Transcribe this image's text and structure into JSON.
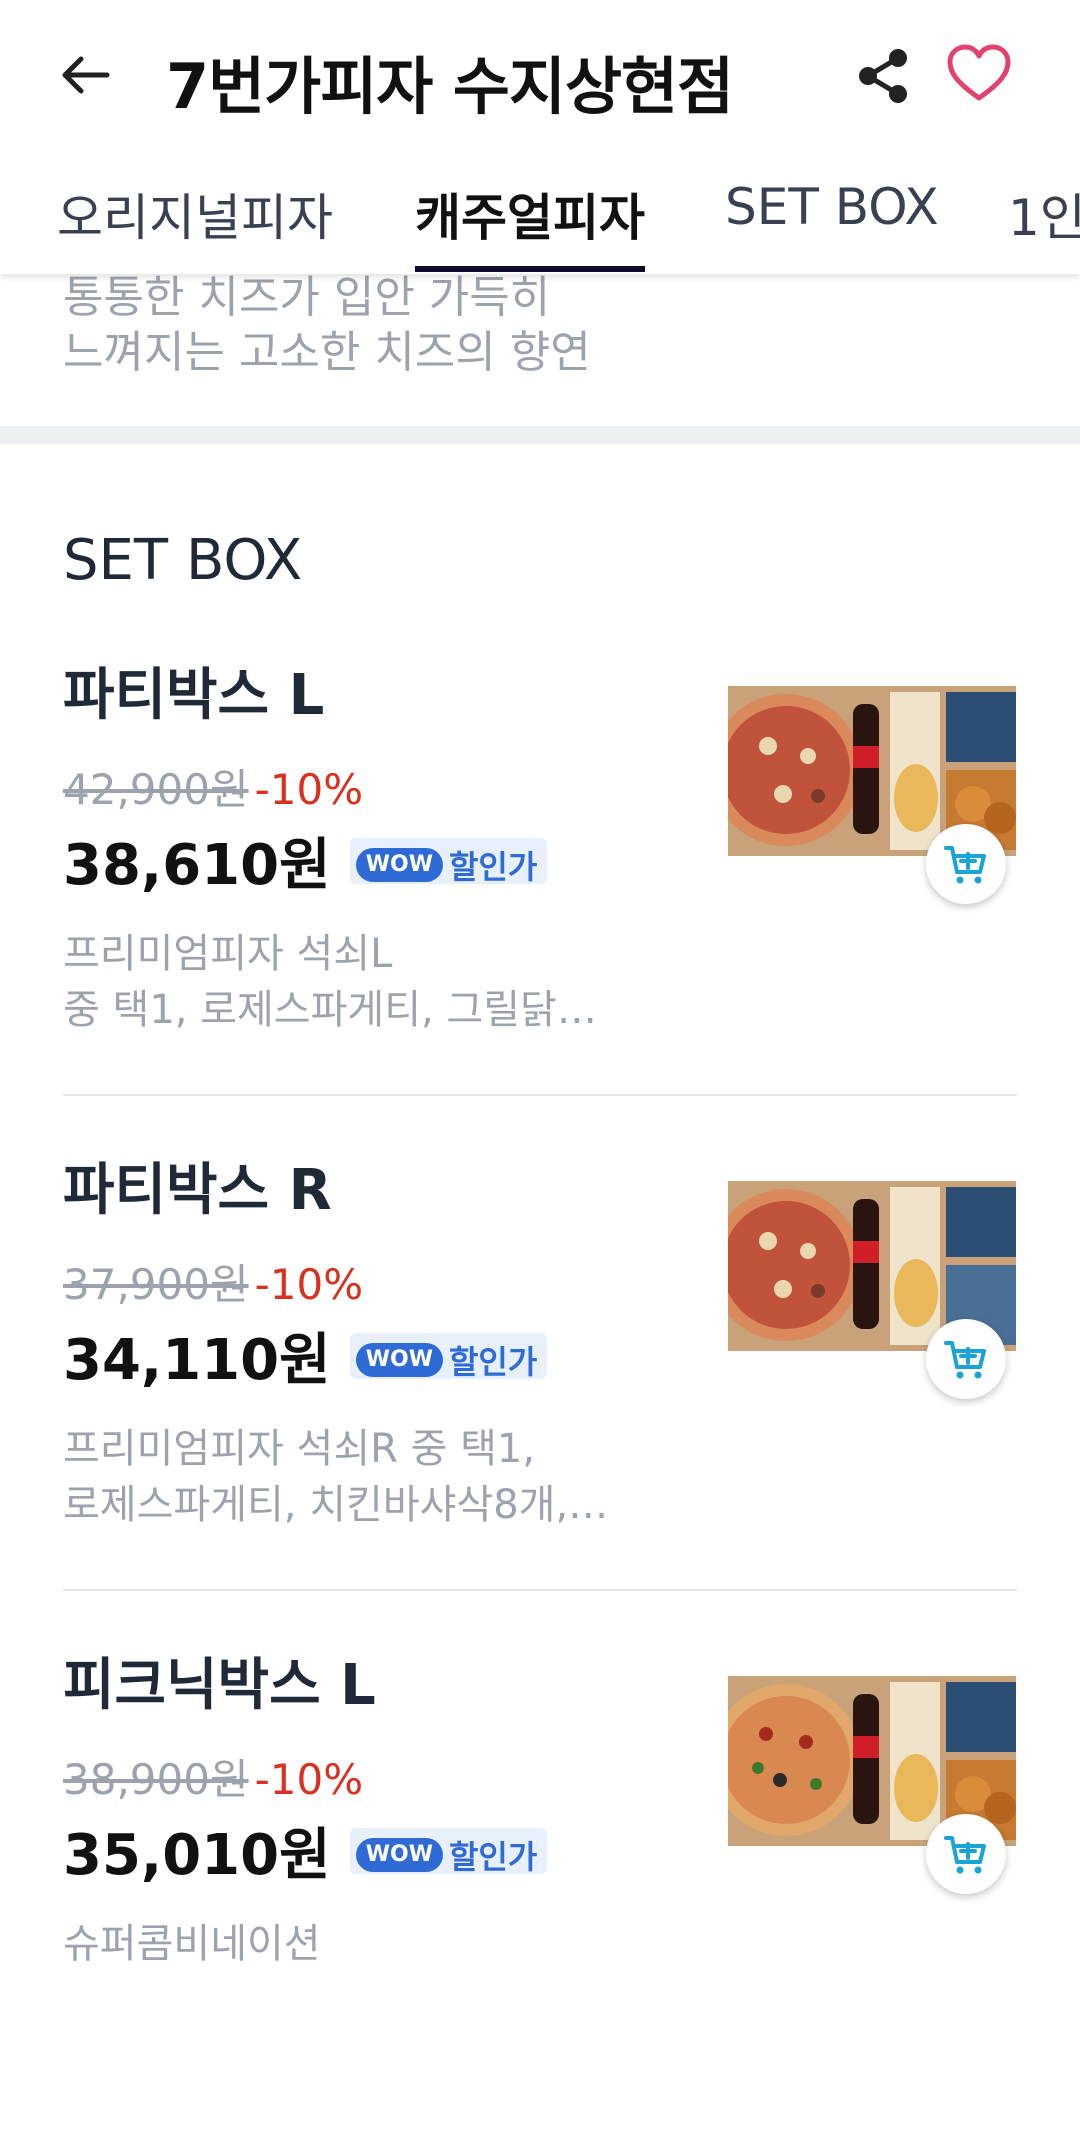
{
  "header": {
    "title": "7번가피자 수지상현점",
    "back_icon": "arrow-left-icon",
    "share_icon": "share-icon",
    "favorite_icon": "heart-icon",
    "favorite_color": "#e2436e"
  },
  "tabs": [
    {
      "label": "오리지널피자",
      "active": false
    },
    {
      "label": "캐주얼피자",
      "active": true
    },
    {
      "label": "SET BOX",
      "active": false
    },
    {
      "label": "1인",
      "active": false
    }
  ],
  "intro": {
    "line1": "통통한 치즈가 입안 가득히",
    "line2": "느껴지는 고소한 치즈의 향연"
  },
  "section": {
    "title": "SET BOX"
  },
  "items": [
    {
      "name": "파티박스 L",
      "original_price": "42,900원",
      "discount": "-10%",
      "price": "38,610원",
      "badge": "WOW",
      "badge_text": "할인가",
      "desc1": "프리미엄피자 석쇠L",
      "desc2": "중 택1, 로제스파게티, 그릴닭…"
    },
    {
      "name": "파티박스 R",
      "original_price": "37,900원",
      "discount": "-10%",
      "price": "34,110원",
      "badge": "WOW",
      "badge_text": "할인가",
      "desc1": "프리미엄피자 석쇠R 중 택1,",
      "desc2": "로제스파게티, 치킨바샤삭8개,…"
    },
    {
      "name": "피크닉박스 L",
      "original_price": "38,900원",
      "discount": "-10%",
      "price": "35,010원",
      "badge": "WOW",
      "badge_text": "할인가",
      "desc1": "슈퍼콤비네이션",
      "desc2": ""
    }
  ],
  "colors": {
    "accent_blue": "#2f6bd4",
    "discount_red": "#d9301f",
    "tab_underline": "#0f0a2e",
    "cart_icon": "#1aa3d6"
  }
}
